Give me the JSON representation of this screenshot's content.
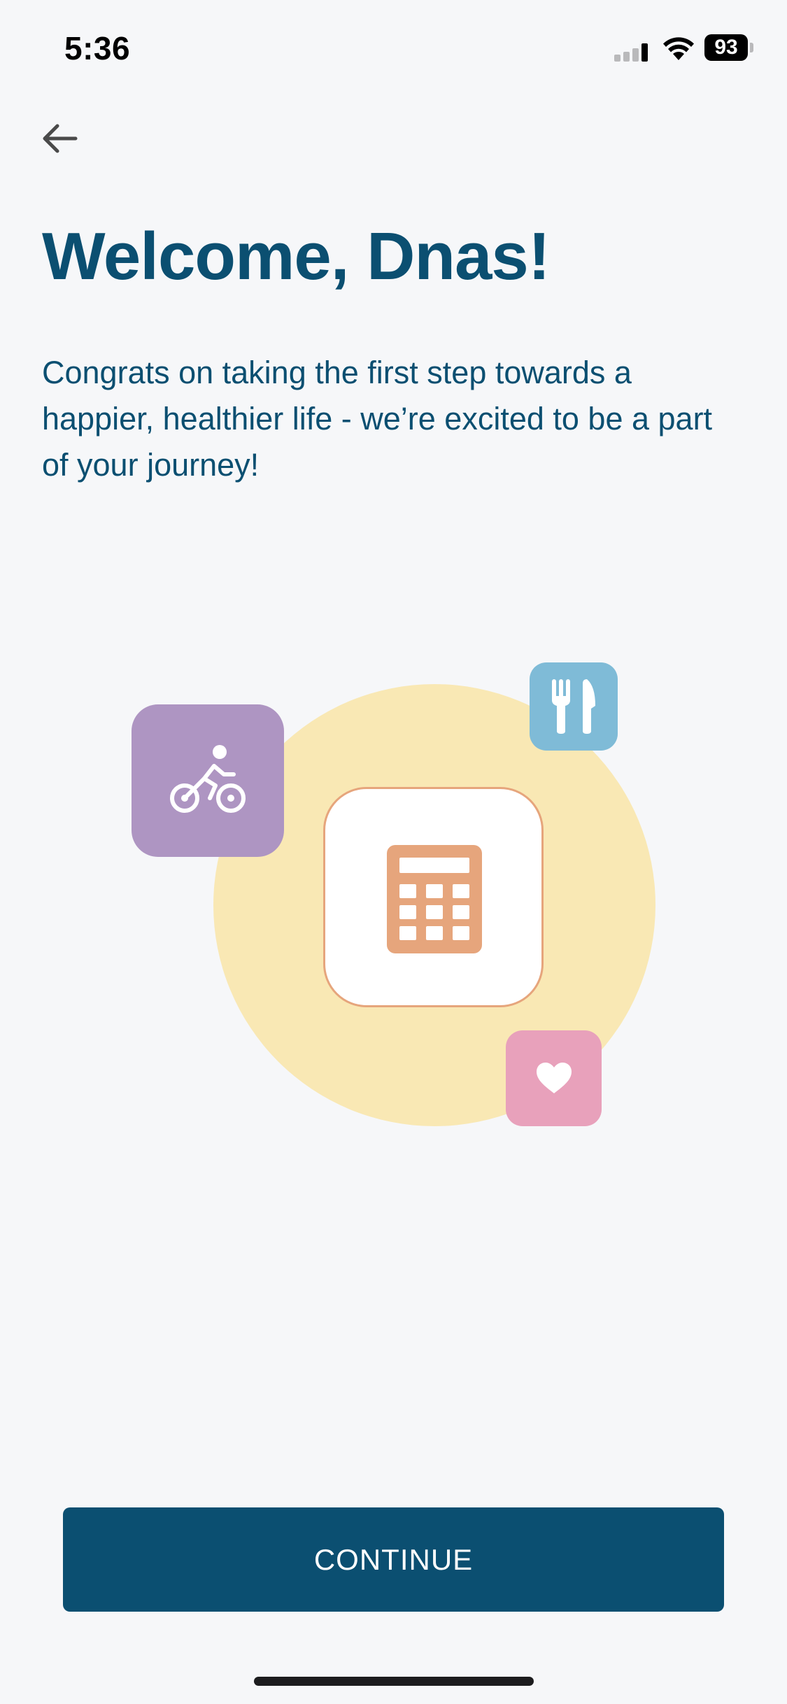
{
  "status_bar": {
    "time": "5:36",
    "battery_level": "93",
    "icons": [
      "signal-icon",
      "wifi-icon",
      "battery-icon"
    ]
  },
  "header": {
    "back_icon": "arrow-left-icon"
  },
  "main": {
    "title": "Welcome, Dnas!",
    "intro": "Congrats on taking the first step towards a happier, healthier life - we’re excited to be a part of your journey!"
  },
  "illustration": {
    "icons": [
      "bike-icon",
      "fork-knife-icon",
      "calculator-icon",
      "heart-icon"
    ],
    "colors": {
      "circle": "#f9e8b4",
      "bike_tile": "#ae95c2",
      "food_tile": "#7fbbd7",
      "calculator": "#e6a57c",
      "heart_tile": "#e8a1bb"
    }
  },
  "footer": {
    "continue_label": "CONTINUE"
  },
  "colors": {
    "brand": "#0b4f71",
    "background": "#f6f7f9"
  }
}
